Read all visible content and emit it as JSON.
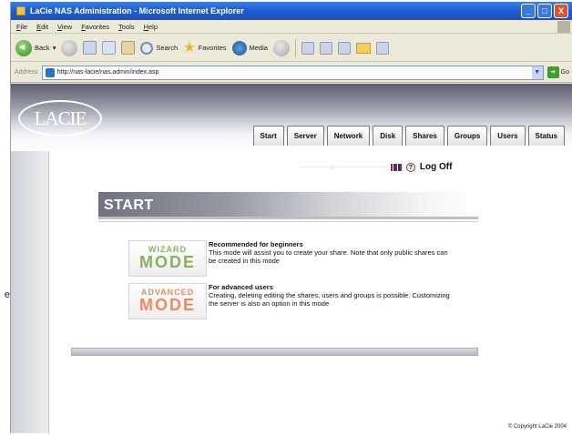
{
  "window": {
    "title": "LaCie NAS Administration - Microsoft Internet Explorer",
    "controls": [
      "_",
      "□",
      "X"
    ]
  },
  "menu": [
    "File",
    "Edit",
    "View",
    "Favorites",
    "Tools",
    "Help"
  ],
  "toolbar": {
    "back": "Back",
    "search": "Search",
    "favorites": "Favorites",
    "media": "Media"
  },
  "address": {
    "label": "Address",
    "url": "http://nas-lacie/nas.admin/index.asp",
    "go": "Go"
  },
  "page": {
    "logo": "LACIE",
    "tabs": [
      "Start",
      "Server",
      "Network",
      "Disk",
      "Shares",
      "Groups",
      "Users",
      "Status"
    ],
    "logoff": "Log Off",
    "help": "?",
    "section_title": "START",
    "wizard": {
      "line1": "WIZARD",
      "line2": "MODE",
      "heading": "Recommended for beginners",
      "text": "This mode will assist you to create your share. Note that only public shares can be created in this mode"
    },
    "advanced": {
      "line1": "ADVANCED",
      "line2": "MODE",
      "heading": "For advanced users",
      "text": "Creating, deleting editing the shares, users and groups is possible. Customizing the server is also an option in this mode"
    },
    "copyright": "© Copyright LaCie 2004"
  },
  "outside_glyph": "e",
  "colors": {
    "titlebar": "#1f5fd0",
    "wizard": "#8bb05f",
    "advanced": "#ee8a62"
  }
}
